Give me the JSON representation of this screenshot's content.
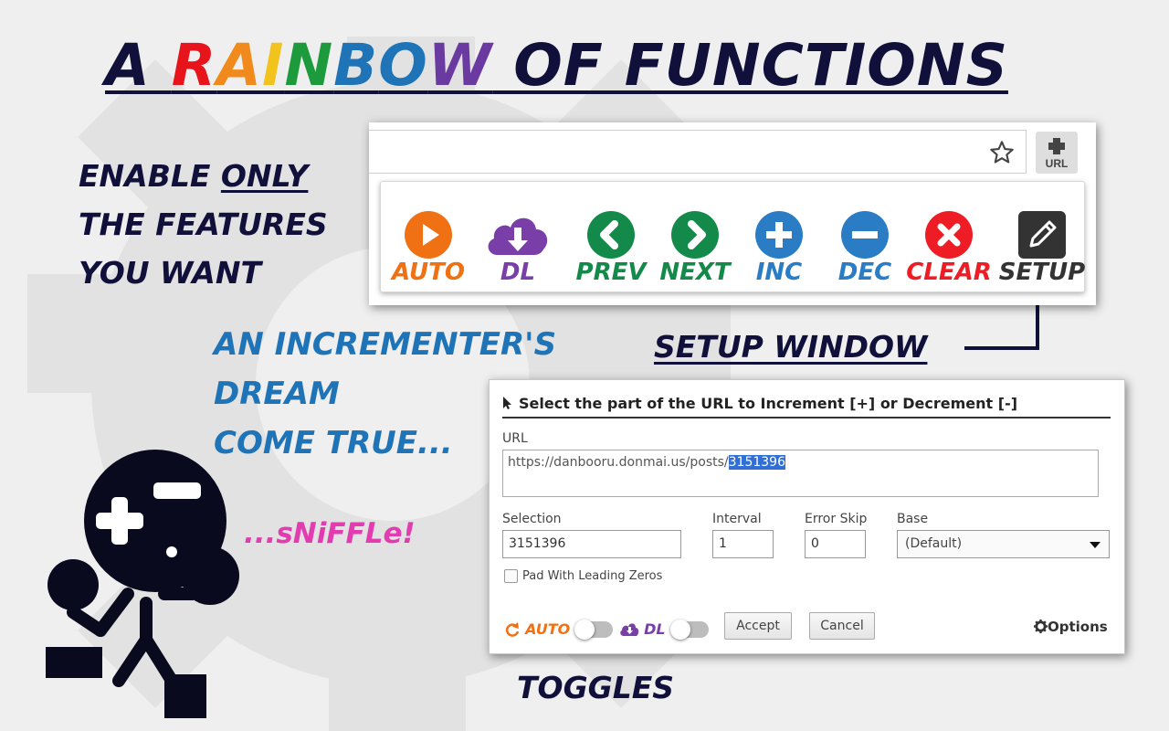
{
  "title": {
    "prefix": "A ",
    "rainbow_letters": [
      {
        "char": "R",
        "color": "#e8141c"
      },
      {
        "char": "A",
        "color": "#f08a1c"
      },
      {
        "char": "I",
        "color": "#f2c21d"
      },
      {
        "char": "N",
        "color": "#1c9a3c"
      },
      {
        "char": "B",
        "color": "#1f74b8"
      },
      {
        "char": "O",
        "color": "#1f74b8"
      },
      {
        "char": "W",
        "color": "#6b3aa0"
      }
    ],
    "suffix": " OF FUNCTIONS"
  },
  "enable_text": {
    "line1_a": "ENABLE ",
    "line1_b": "ONLY",
    "line2": "THE FEATURES",
    "line3": "YOU WANT"
  },
  "dream_text": {
    "line1": "AN INCREMENTER'S",
    "line2": "DREAM",
    "line3": "COME TRUE..."
  },
  "sniffle": "...sNiFFLe!",
  "toggles_label": "TOGGLES",
  "setup_window_label": "SETUP WINDOW",
  "extension_button": {
    "icon": "plus-url-icon",
    "label": "URL"
  },
  "popup_buttons": [
    {
      "label": "AUTO",
      "icon": "play-icon",
      "color": "#f07014"
    },
    {
      "label": "DL",
      "icon": "cloud-download-icon",
      "color": "#7a3ea8"
    },
    {
      "label": "PREV",
      "icon": "chevron-left-icon",
      "color": "#148a4a"
    },
    {
      "label": "NEXT",
      "icon": "chevron-right-icon",
      "color": "#148a4a"
    },
    {
      "label": "INC",
      "icon": "plus-circle-icon",
      "color": "#2a7dc4"
    },
    {
      "label": "DEC",
      "icon": "minus-circle-icon",
      "color": "#2a7dc4"
    },
    {
      "label": "CLEAR",
      "icon": "close-circle-icon",
      "color": "#ee1c24"
    },
    {
      "label": "SETUP",
      "icon": "pencil-icon",
      "color": "#333333"
    }
  ],
  "setup": {
    "header": "Select the part of the URL to Increment [+] or Decrement [-]",
    "url_label": "URL",
    "url_prefix": "https://danbooru.donmai.us/posts/",
    "url_selected": "3151396",
    "selection_label": "Selection",
    "selection_value": "3151396",
    "interval_label": "Interval",
    "interval_value": "1",
    "error_skip_label": "Error Skip",
    "error_skip_value": "0",
    "base_label": "Base",
    "base_value": "(Default)",
    "pad_label": "Pad With Leading Zeros",
    "auto_toggle_label": "AUTO",
    "dl_toggle_label": "DL",
    "accept_label": "Accept",
    "cancel_label": "Cancel",
    "options_label": "Options"
  }
}
